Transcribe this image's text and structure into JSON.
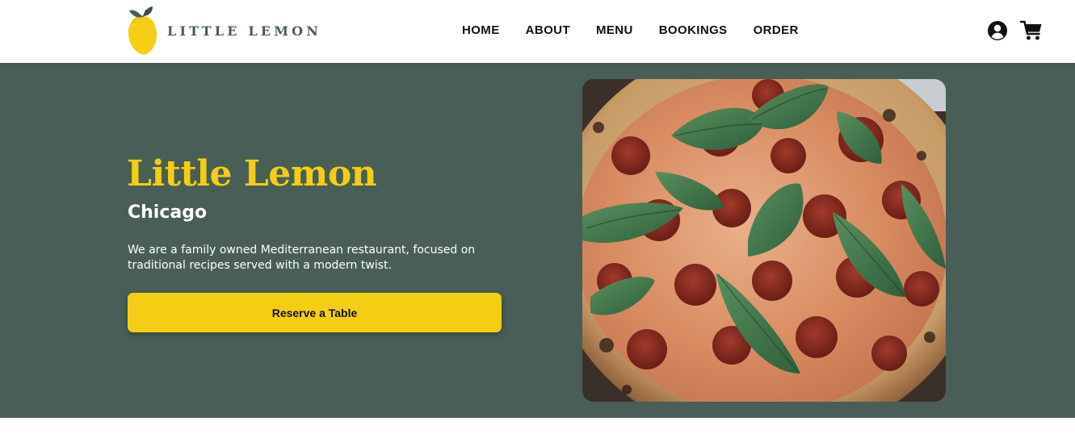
{
  "brand": {
    "name": "LITTLE LEMON",
    "colors": {
      "primary": "#495e57",
      "accent": "#f4ce14"
    }
  },
  "nav": {
    "items": [
      {
        "label": "HOME"
      },
      {
        "label": "ABOUT"
      },
      {
        "label": "MENU"
      },
      {
        "label": "BOOKINGS"
      },
      {
        "label": "ORDER"
      }
    ]
  },
  "header_icons": [
    "account-icon",
    "cart-icon"
  ],
  "hero": {
    "title": "Little Lemon",
    "subtitle": "Chicago",
    "description": "We are a family owned Mediterranean restaurant, focused on traditional recipes served with a modern twist.",
    "cta_label": "Reserve a Table",
    "image": "pizza-photo"
  }
}
